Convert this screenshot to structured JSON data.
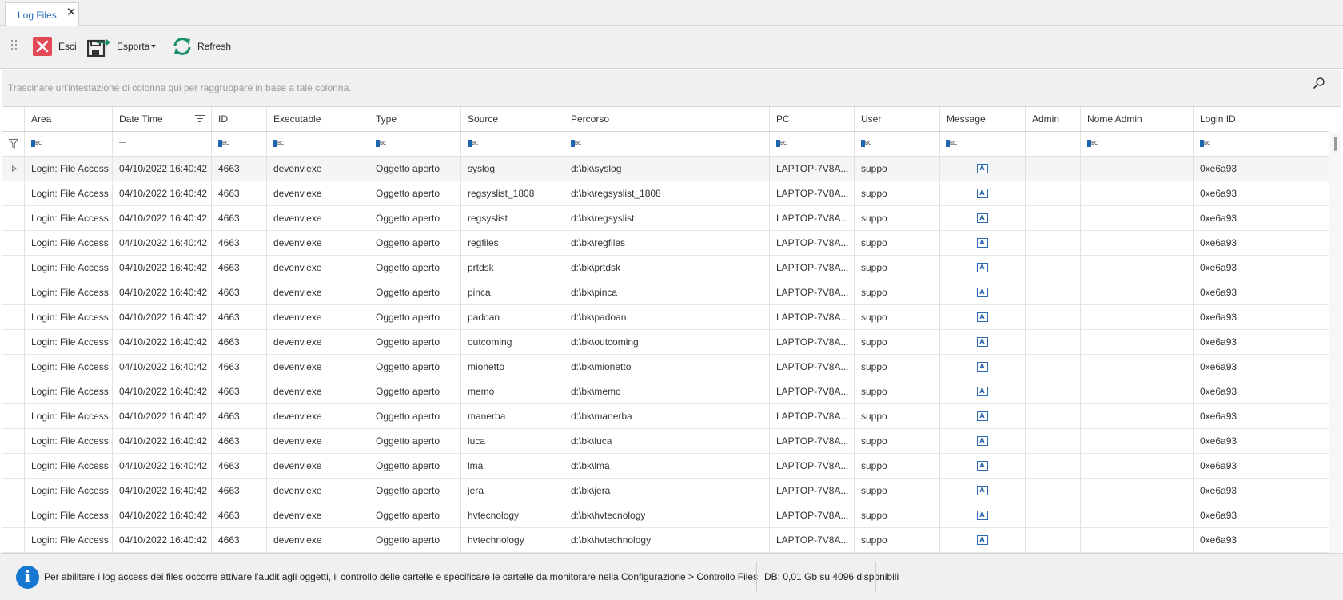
{
  "tab": {
    "title": "Log Files",
    "close": "✕"
  },
  "toolbar": {
    "exit_label": "Esci",
    "export_label": "Esporta",
    "refresh_label": "Refresh"
  },
  "group_panel": {
    "hint": "Trascinare un'intestazione di colonna qui per raggruppare in base a tale colonna."
  },
  "columns": [
    "Area",
    "Date Time",
    "ID",
    "Executable",
    "Type",
    "Source",
    "Percorso",
    "PC",
    "User",
    "Message",
    "Admin",
    "Nome Admin",
    "Login ID"
  ],
  "filter_row": [
    "abc",
    "=",
    "abc",
    "abc",
    "abc",
    "abc",
    "abc",
    "abc",
    "abc",
    "abc",
    "",
    "abc",
    "abc"
  ],
  "rows": [
    {
      "area": "Login: File Access",
      "datetime": "04/10/2022 16:40:42",
      "id": "4663",
      "exe": "devenv.exe",
      "type": "Oggetto aperto",
      "source": "syslog",
      "path": "d:\\bk\\syslog",
      "pc": "LAPTOP-7V8A...",
      "user": "suppo",
      "admin": "",
      "nome_admin": "",
      "login_id": "0xe6a93"
    },
    {
      "area": "Login: File Access",
      "datetime": "04/10/2022 16:40:42",
      "id": "4663",
      "exe": "devenv.exe",
      "type": "Oggetto aperto",
      "source": "regsyslist_1808",
      "path": "d:\\bk\\regsyslist_1808",
      "pc": "LAPTOP-7V8A...",
      "user": "suppo",
      "admin": "",
      "nome_admin": "",
      "login_id": "0xe6a93"
    },
    {
      "area": "Login: File Access",
      "datetime": "04/10/2022 16:40:42",
      "id": "4663",
      "exe": "devenv.exe",
      "type": "Oggetto aperto",
      "source": "regsyslist",
      "path": "d:\\bk\\regsyslist",
      "pc": "LAPTOP-7V8A...",
      "user": "suppo",
      "admin": "",
      "nome_admin": "",
      "login_id": "0xe6a93"
    },
    {
      "area": "Login: File Access",
      "datetime": "04/10/2022 16:40:42",
      "id": "4663",
      "exe": "devenv.exe",
      "type": "Oggetto aperto",
      "source": "regfiles",
      "path": "d:\\bk\\regfiles",
      "pc": "LAPTOP-7V8A...",
      "user": "suppo",
      "admin": "",
      "nome_admin": "",
      "login_id": "0xe6a93"
    },
    {
      "area": "Login: File Access",
      "datetime": "04/10/2022 16:40:42",
      "id": "4663",
      "exe": "devenv.exe",
      "type": "Oggetto aperto",
      "source": "prtdsk",
      "path": "d:\\bk\\prtdsk",
      "pc": "LAPTOP-7V8A...",
      "user": "suppo",
      "admin": "",
      "nome_admin": "",
      "login_id": "0xe6a93"
    },
    {
      "area": "Login: File Access",
      "datetime": "04/10/2022 16:40:42",
      "id": "4663",
      "exe": "devenv.exe",
      "type": "Oggetto aperto",
      "source": "pinca",
      "path": "d:\\bk\\pinca",
      "pc": "LAPTOP-7V8A...",
      "user": "suppo",
      "admin": "",
      "nome_admin": "",
      "login_id": "0xe6a93"
    },
    {
      "area": "Login: File Access",
      "datetime": "04/10/2022 16:40:42",
      "id": "4663",
      "exe": "devenv.exe",
      "type": "Oggetto aperto",
      "source": "padoan",
      "path": "d:\\bk\\padoan",
      "pc": "LAPTOP-7V8A...",
      "user": "suppo",
      "admin": "",
      "nome_admin": "",
      "login_id": "0xe6a93"
    },
    {
      "area": "Login: File Access",
      "datetime": "04/10/2022 16:40:42",
      "id": "4663",
      "exe": "devenv.exe",
      "type": "Oggetto aperto",
      "source": "outcoming",
      "path": "d:\\bk\\outcoming",
      "pc": "LAPTOP-7V8A...",
      "user": "suppo",
      "admin": "",
      "nome_admin": "",
      "login_id": "0xe6a93"
    },
    {
      "area": "Login: File Access",
      "datetime": "04/10/2022 16:40:42",
      "id": "4663",
      "exe": "devenv.exe",
      "type": "Oggetto aperto",
      "source": "mionetto",
      "path": "d:\\bk\\mionetto",
      "pc": "LAPTOP-7V8A...",
      "user": "suppo",
      "admin": "",
      "nome_admin": "",
      "login_id": "0xe6a93"
    },
    {
      "area": "Login: File Access",
      "datetime": "04/10/2022 16:40:42",
      "id": "4663",
      "exe": "devenv.exe",
      "type": "Oggetto aperto",
      "source": "memo",
      "path": "d:\\bk\\memo",
      "pc": "LAPTOP-7V8A...",
      "user": "suppo",
      "admin": "",
      "nome_admin": "",
      "login_id": "0xe6a93"
    },
    {
      "area": "Login: File Access",
      "datetime": "04/10/2022 16:40:42",
      "id": "4663",
      "exe": "devenv.exe",
      "type": "Oggetto aperto",
      "source": "manerba",
      "path": "d:\\bk\\manerba",
      "pc": "LAPTOP-7V8A...",
      "user": "suppo",
      "admin": "",
      "nome_admin": "",
      "login_id": "0xe6a93"
    },
    {
      "area": "Login: File Access",
      "datetime": "04/10/2022 16:40:42",
      "id": "4663",
      "exe": "devenv.exe",
      "type": "Oggetto aperto",
      "source": "luca",
      "path": "d:\\bk\\luca",
      "pc": "LAPTOP-7V8A...",
      "user": "suppo",
      "admin": "",
      "nome_admin": "",
      "login_id": "0xe6a93"
    },
    {
      "area": "Login: File Access",
      "datetime": "04/10/2022 16:40:42",
      "id": "4663",
      "exe": "devenv.exe",
      "type": "Oggetto aperto",
      "source": "lma",
      "path": "d:\\bk\\lma",
      "pc": "LAPTOP-7V8A...",
      "user": "suppo",
      "admin": "",
      "nome_admin": "",
      "login_id": "0xe6a93"
    },
    {
      "area": "Login: File Access",
      "datetime": "04/10/2022 16:40:42",
      "id": "4663",
      "exe": "devenv.exe",
      "type": "Oggetto aperto",
      "source": "jera",
      "path": "d:\\bk\\jera",
      "pc": "LAPTOP-7V8A...",
      "user": "suppo",
      "admin": "",
      "nome_admin": "",
      "login_id": "0xe6a93"
    },
    {
      "area": "Login: File Access",
      "datetime": "04/10/2022 16:40:42",
      "id": "4663",
      "exe": "devenv.exe",
      "type": "Oggetto aperto",
      "source": "hvtecnology",
      "path": "d:\\bk\\hvtecnology",
      "pc": "LAPTOP-7V8A...",
      "user": "suppo",
      "admin": "",
      "nome_admin": "",
      "login_id": "0xe6a93"
    },
    {
      "area": "Login: File Access",
      "datetime": "04/10/2022 16:40:42",
      "id": "4663",
      "exe": "devenv.exe",
      "type": "Oggetto aperto",
      "source": "hvtechnology",
      "path": "d:\\bk\\hvtechnology",
      "pc": "LAPTOP-7V8A...",
      "user": "suppo",
      "admin": "",
      "nome_admin": "",
      "login_id": "0xe6a93"
    }
  ],
  "status": {
    "message": "Per abilitare i log access dei files occorre attivare l'audit agli oggetti, il controllo delle cartelle e specificare le cartelle da monitorare nella Configurazione > Controllo Files",
    "db": "DB: 0,01 Gb su 4096 disponibili"
  },
  "colors": {
    "accent": "#2d6cb5",
    "exit_red": "#e24b55",
    "refresh_green": "#1a8f6f",
    "info_blue": "#1677d0"
  },
  "icons": [
    "close-icon",
    "grip-icon",
    "exit-icon",
    "export-icon",
    "refresh-icon",
    "search-icon",
    "sort-icon",
    "filter-funnel-icon",
    "abc-filter-icon",
    "equal-filter-icon",
    "memo-icon",
    "row-indicator-icon",
    "info-icon"
  ]
}
